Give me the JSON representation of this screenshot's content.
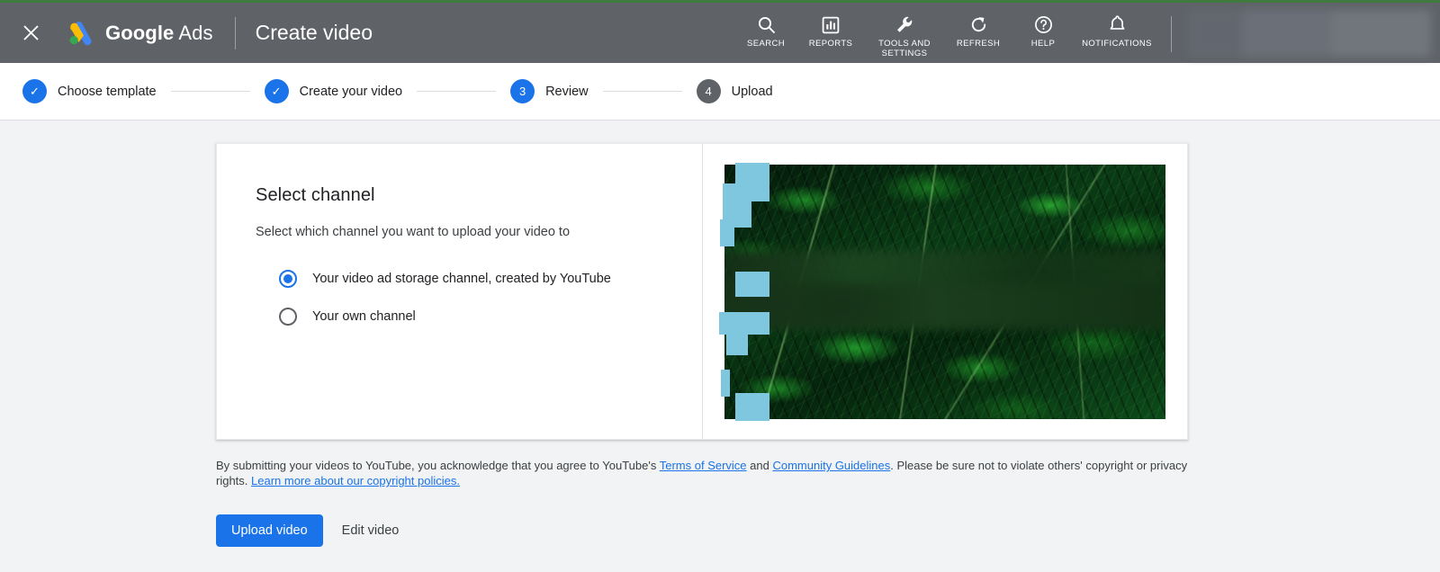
{
  "theme": {
    "header_bg": "#5f6368",
    "accent_blue": "#1a73e8",
    "top_accent_green": "#3f7a3f",
    "page_bg": "#f1f3f4",
    "redaction_blue": "#7fc6df"
  },
  "header": {
    "close_icon": "close-icon",
    "brand_google": "Google",
    "brand_ads": "Ads",
    "page_title": "Create video",
    "tools": [
      {
        "icon": "search-icon",
        "label": "SEARCH"
      },
      {
        "icon": "reports-icon",
        "label": "REPORTS"
      },
      {
        "icon": "wrench-icon",
        "label": "TOOLS AND\nSETTINGS"
      },
      {
        "icon": "refresh-icon",
        "label": "REFRESH"
      },
      {
        "icon": "help-icon",
        "label": "HELP"
      },
      {
        "icon": "bell-icon",
        "label": "NOTIFICATIONS"
      }
    ]
  },
  "stepper": {
    "steps": [
      {
        "marker": "✓",
        "state": "done",
        "label": "Choose template"
      },
      {
        "marker": "✓",
        "state": "done",
        "label": "Create your video"
      },
      {
        "marker": "3",
        "state": "active",
        "label": "Review"
      },
      {
        "marker": "4",
        "state": "todo",
        "label": "Upload"
      }
    ]
  },
  "card": {
    "title": "Select channel",
    "subtitle": "Select which channel you want to upload your video to",
    "options": [
      {
        "label": "Your video ad storage channel, created by YouTube",
        "selected": true
      },
      {
        "label": "Your own channel",
        "selected": false
      }
    ],
    "preview": {
      "name": "video-preview",
      "description": "Dark green fern foliage video thumbnail with redaction overlays"
    }
  },
  "legal": {
    "part1": "By submitting your videos to YouTube, you acknowledge that you agree to YouTube's ",
    "link_tos": "Terms of Service",
    "part2": " and ",
    "link_guidelines": "Community Guidelines",
    "part3": ". Please be sure not to violate others' copyright or privacy rights. ",
    "link_copyright": "Learn more about our copyright policies."
  },
  "actions": {
    "primary_label": "Upload video",
    "secondary_label": "Edit video"
  }
}
